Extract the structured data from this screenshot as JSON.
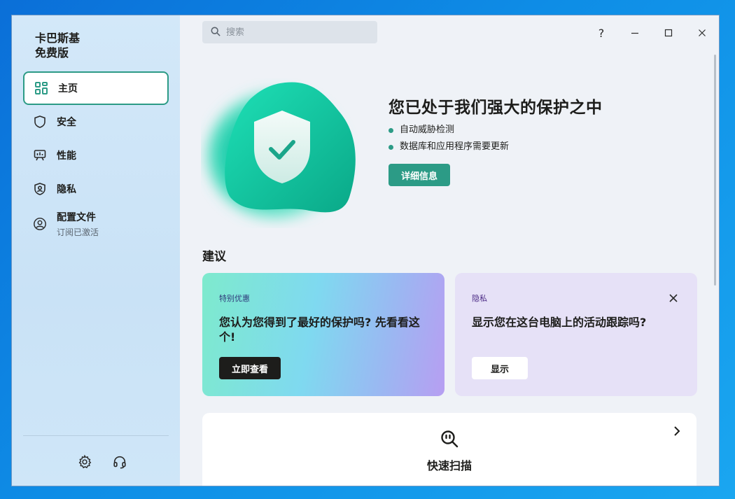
{
  "app": {
    "brand_line1": "卡巴斯基",
    "brand_line2": "免费版"
  },
  "sidebar": {
    "items": [
      {
        "label": "主页",
        "icon": "home-grid-icon",
        "active": true
      },
      {
        "label": "安全",
        "icon": "shield-icon"
      },
      {
        "label": "性能",
        "icon": "performance-icon"
      },
      {
        "label": "隐私",
        "icon": "privacy-shield-icon"
      },
      {
        "label": "配置文件",
        "sub": "订阅已激活",
        "icon": "profile-icon"
      }
    ],
    "bottom_icons": [
      "gear-icon",
      "headset-icon"
    ]
  },
  "search": {
    "placeholder": "搜索"
  },
  "window_controls": {
    "help": "?"
  },
  "hero": {
    "title": "您已处于我们强大的保护之中",
    "bullets": [
      "自动威胁检测",
      "数据库和应用程序需要更新"
    ],
    "button": "详细信息",
    "accent_color": "#2c9b86"
  },
  "suggestions": {
    "title": "建议",
    "cards": [
      {
        "tag": "特别优惠",
        "title": "您认为您得到了最好的保护吗? 先看看这个!",
        "button": "立即查看"
      },
      {
        "tag": "隐私",
        "title": "显示您在这台电脑上的活动跟踪吗?",
        "button": "显示"
      }
    ]
  },
  "quick_scan": {
    "label": "快速扫描"
  }
}
